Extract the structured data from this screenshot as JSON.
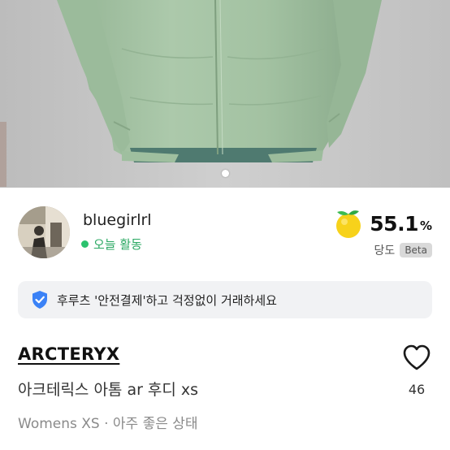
{
  "gallery": {
    "image_alt": "jacket photo",
    "current_index": 1,
    "total": 1
  },
  "seller": {
    "name": "bluegirlrl",
    "activity": "오늘 활동",
    "score_value": "55.1",
    "score_unit": "%",
    "score_label": "당도",
    "score_badge": "Beta"
  },
  "notice": {
    "icon": "shield-check-icon",
    "text": "후루츠 '안전결제'하고 걱정없이 거래하세요"
  },
  "product": {
    "brand": "ARCTERYX",
    "title": "아크테릭스 아톰 ar 후디 xs",
    "meta": "Womens XS · 아주 좋은 상태",
    "like_count": "46"
  },
  "colors": {
    "accent_green": "#2bc26e",
    "jacket": "#a8c6a8",
    "notice_bg": "#f1f2f4"
  }
}
